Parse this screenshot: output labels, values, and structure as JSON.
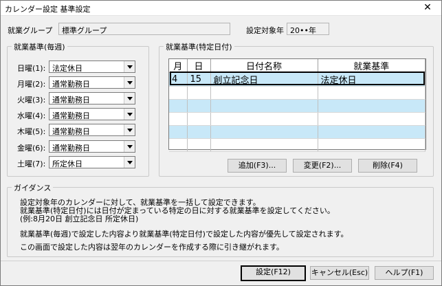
{
  "window": {
    "title": "カレンダー設定 基準設定",
    "close_glyph": "✕"
  },
  "header": {
    "group_label": "就業グループ",
    "group_value": "標準グループ",
    "year_label": "設定対象年",
    "year_value": "20••年"
  },
  "weekly": {
    "legend": "就業基準(毎週)",
    "days": [
      {
        "label": "日曜(1):",
        "value": "法定休日"
      },
      {
        "label": "月曜(2):",
        "value": "通常勤務日"
      },
      {
        "label": "火曜(3):",
        "value": "通常勤務日"
      },
      {
        "label": "水曜(4):",
        "value": "通常勤務日"
      },
      {
        "label": "木曜(5):",
        "value": "通常勤務日"
      },
      {
        "label": "金曜(6):",
        "value": "通常勤務日"
      },
      {
        "label": "土曜(7):",
        "value": "所定休日"
      }
    ]
  },
  "specific": {
    "legend": "就業基準(特定日付)",
    "columns": [
      "月",
      "日",
      "日付名称",
      "就業基準"
    ],
    "rows": [
      {
        "month": "4",
        "day": "15",
        "name": "創立記念日",
        "standard": "法定休日"
      }
    ],
    "add_label": "追加(F3)...",
    "edit_label": "変更(F2)...",
    "delete_label": "削除(F4)"
  },
  "guidance": {
    "legend": "ガイダンス",
    "lines": [
      "設定対象年のカレンダーに対して、就業基準を一括して設定できます。",
      "就業基準(特定日付)には日付が定まっている特定の日に対する就業基準を設定してください。",
      "(例:8月20日 創立記念日 所定休日)",
      "就業基準(毎週)で設定した内容より就業基準(特定日付)で設定した内容が優先して設定されます。",
      "この画面で設定した内容は翌年のカレンダーを作成する際に引き継がれます。"
    ]
  },
  "footer": {
    "ok_label": "設定(F12)",
    "cancel_label": "キャンセル(Esc)",
    "help_label": "ヘルプ(F1)"
  }
}
